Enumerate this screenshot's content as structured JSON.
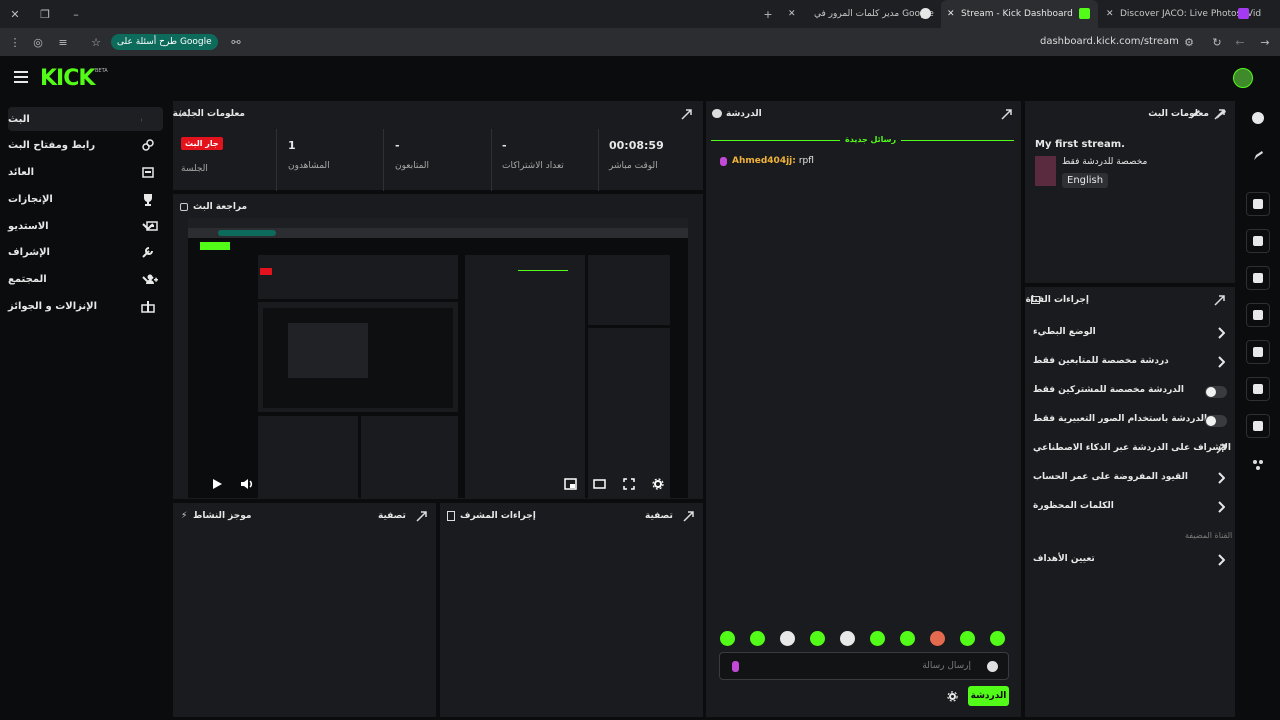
{
  "browser": {
    "tabs": [
      {
        "label": "Discover JACO: Live Photos, Vid"
      },
      {
        "label": "Stream - Kick Dashboard"
      },
      {
        "label": "مدير كلمات المرور في Google"
      }
    ],
    "address": "dashboard.kick.com/stream",
    "ask_google": "طرح أسئلة على Google"
  },
  "brand": {
    "logo": "KICK",
    "badge": "BETA",
    "color": "#53fc18"
  },
  "sidebar": {
    "items": [
      {
        "label": "البث",
        "icon": "broadcast-icon"
      },
      {
        "label": "رابط ومفتاح البث",
        "icon": "link-icon"
      },
      {
        "label": "العائد",
        "icon": "revenue-icon"
      },
      {
        "label": "الإنجازات",
        "icon": "trophy-icon"
      },
      {
        "label": "الاستديو",
        "icon": "studio-icon"
      },
      {
        "label": "الإشراف",
        "icon": "wrench-icon"
      },
      {
        "label": "المجتمع",
        "icon": "community-icon"
      },
      {
        "label": "الإنزالات و الجوائز",
        "icon": "gift-icon"
      }
    ]
  },
  "session": {
    "title": "معلومات الجلسة",
    "stats": [
      {
        "value": "00:08:59",
        "label": "الوقت مباشر"
      },
      {
        "value": "-",
        "label": "تعداد الاشتراكات"
      },
      {
        "value": "-",
        "label": "المتابعون"
      },
      {
        "value": "1",
        "label": "المشاهدون"
      }
    ],
    "live_badge": "جار البث",
    "session_label": "الجلسة"
  },
  "preview": {
    "title": "مراجعة البث"
  },
  "activity": {
    "title": "موجز النشاط",
    "filter": "تصفية"
  },
  "mod_actions": {
    "title": "إجراءات المشرف",
    "filter": "تصفية"
  },
  "chat": {
    "title": "الدردشة",
    "new_messages": "رسائل جديدة",
    "messages": [
      {
        "user": "Ahmed404jj:",
        "text": "rpfl"
      }
    ],
    "input_placeholder": "إرسال رسالة",
    "send_label": "الدردشة"
  },
  "stream_info": {
    "title": "معلومات البث",
    "stream_title": "My first stream.",
    "category": "مخصصة للدردشة فقط",
    "language": "English"
  },
  "channel_actions": {
    "title": "إجراءات القناة",
    "rows": [
      {
        "label": "الوضع البطيء",
        "control": "chevron"
      },
      {
        "label": "دردشة مخصصة للمتابعين فقط",
        "control": "chevron"
      },
      {
        "label": "الدردشة مخصصة للمشتركين فقط",
        "control": "toggle"
      },
      {
        "label": "الدردشة باستخدام الصور التعبيرية فقط",
        "control": "toggle"
      },
      {
        "label": "الإشراف على الدردشة عبر الذكاء الاصطناعي",
        "control": "external"
      },
      {
        "label": "القيود المفروضة على عمر الحساب",
        "control": "chevron"
      },
      {
        "label": "الكلمات المحظورة",
        "control": "chevron"
      }
    ],
    "section_label": "القناة المضيفة",
    "target_label": "تعيين الأهداف"
  },
  "colors": {
    "accent": "#53fc18",
    "live": "#e3131e",
    "panel": "#1a1b1e",
    "bg": "#0b0c0d"
  }
}
